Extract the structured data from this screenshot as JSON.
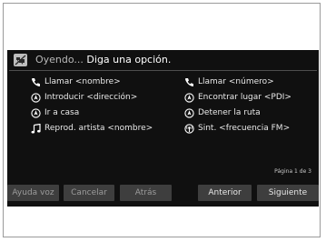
{
  "header": {
    "status_prefix": "Oyendo...",
    "prompt": "Diga una opción."
  },
  "commands": [
    {
      "label": "Llamar <nombre>",
      "icon": "phone-icon"
    },
    {
      "label": "Llamar <número>",
      "icon": "phone-icon"
    },
    {
      "label": "Introducir <dirección>",
      "icon": "navigation-icon"
    },
    {
      "label": "Encontrar lugar <PDI>",
      "icon": "navigation-icon"
    },
    {
      "label": "Ir a casa",
      "icon": "navigation-icon"
    },
    {
      "label": "Detener la ruta",
      "icon": "navigation-icon"
    },
    {
      "label": "Reprod. artista <nombre>",
      "icon": "music-note-icon"
    },
    {
      "label": "Sint. <frecuencia FM>",
      "icon": "radio-icon"
    }
  ],
  "page_indicator": "Página 1 de 3",
  "buttons": [
    {
      "label": "Ayuda voz"
    },
    {
      "label": "Cancelar"
    },
    {
      "label": "Atrás"
    },
    {
      "label": "Anterior"
    },
    {
      "label": "Siguiente"
    }
  ],
  "colors": {
    "screen_bg": "#101010",
    "button_bg": "#3e3e3e",
    "text": "#e9e9e9"
  }
}
